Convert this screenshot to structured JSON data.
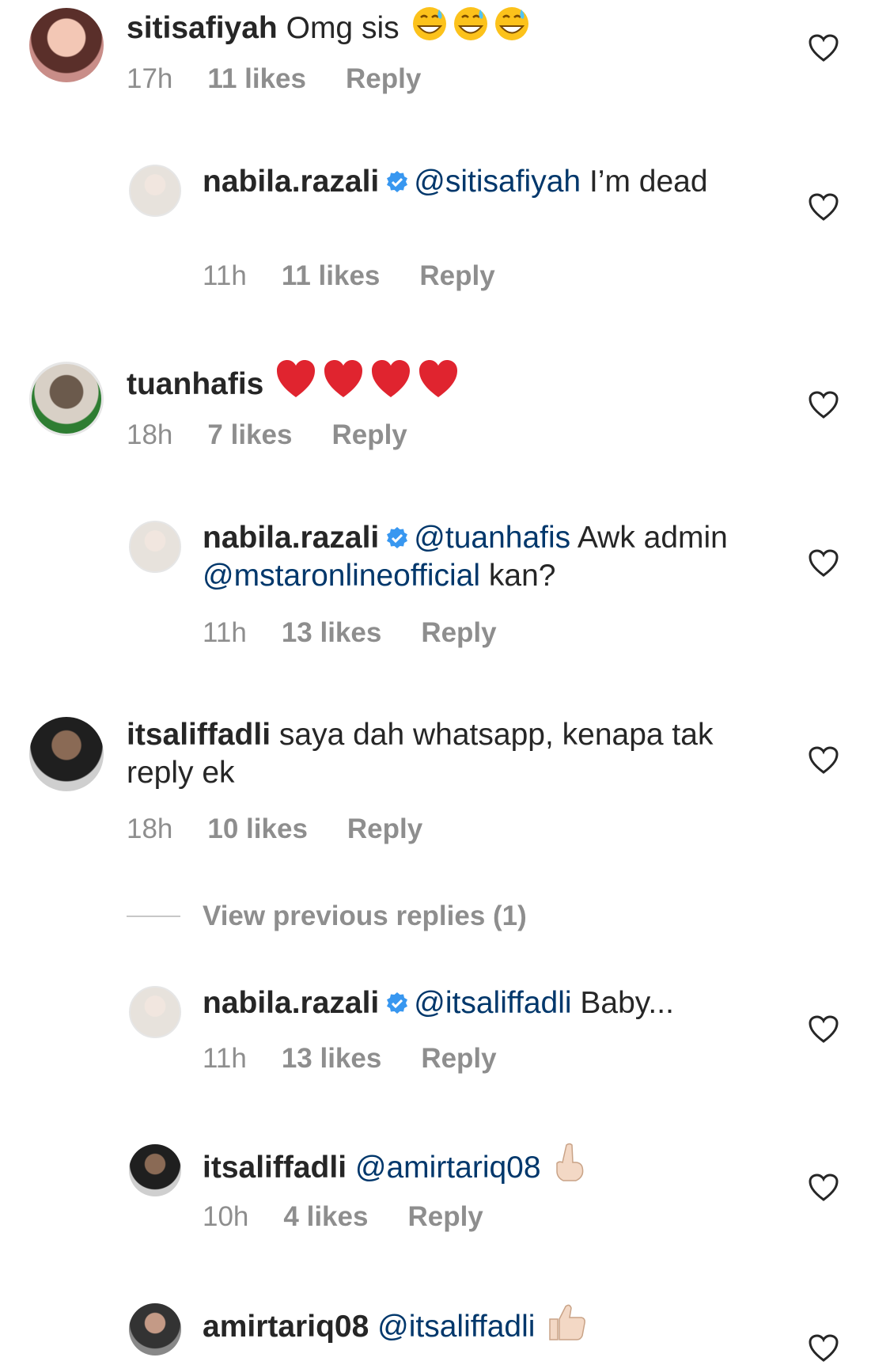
{
  "comments": [
    {
      "user": "sitisafiyah",
      "text": "Omg sis",
      "emoji": "grinning-sweat x3",
      "time": "17h",
      "likes": "11 likes",
      "reply": "Reply"
    },
    {
      "user": "nabila.razali",
      "mention": "@sitisafiyah",
      "text": "I’m dead",
      "time": "11h",
      "likes": "11 likes",
      "reply": "Reply"
    },
    {
      "user": "tuanhafis",
      "emoji": "red-heart x4",
      "time": "18h",
      "likes": "7 likes",
      "reply": "Reply"
    },
    {
      "user": "nabila.razali",
      "mention": "@tuanhafis",
      "text1": "Awk admin",
      "mention2": "@mstaronlineofficial",
      "text2": "kan?",
      "time": "11h",
      "likes": "13 likes",
      "reply": "Reply"
    },
    {
      "user": "itsaliffadli",
      "text": "saya dah whatsapp, kenapa tak reply ek",
      "time": "18h",
      "likes": "10 likes",
      "reply": "Reply"
    },
    {
      "user": "nabila.razali",
      "mention": "@itsaliffadli",
      "text": "Baby...",
      "time": "11h",
      "likes": "13 likes",
      "reply": "Reply"
    },
    {
      "user": "itsaliffadli",
      "mention": "@amirtariq08",
      "emoji": "pointing-up",
      "time": "10h",
      "likes": "4 likes",
      "reply": "Reply"
    },
    {
      "user": "amirtariq08",
      "mention": "@itsaliffadli",
      "emoji": "thumbs-up"
    }
  ],
  "view_previous_replies": "View previous replies (1)",
  "colors": {
    "text": "#262626",
    "secondary": "#8e8e8e",
    "mention": "#00376b",
    "verified": "#3897f0",
    "heart_heart": "#ed4956"
  }
}
